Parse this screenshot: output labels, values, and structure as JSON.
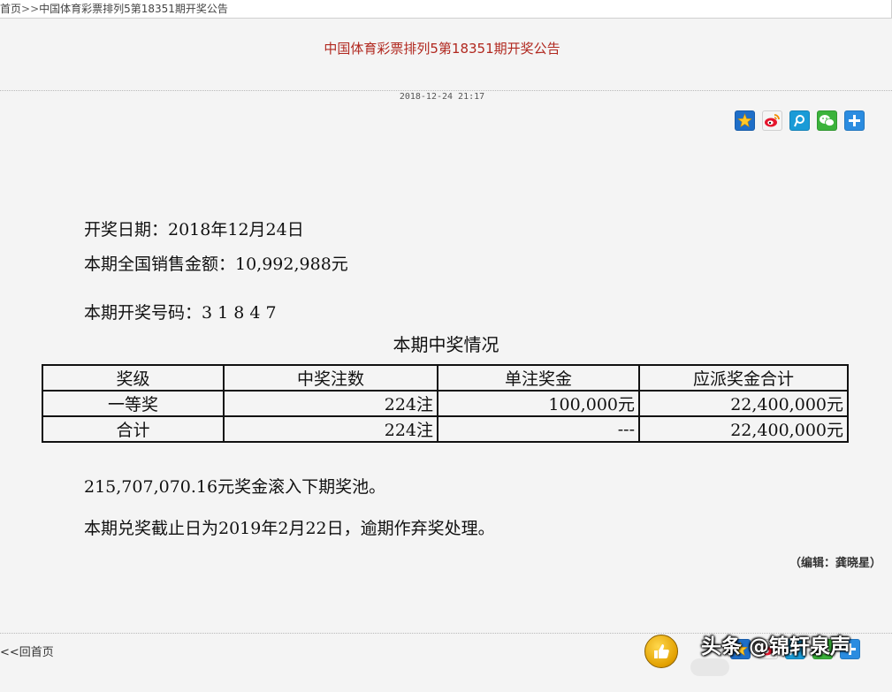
{
  "breadcrumb": {
    "home": "首页",
    "separator": ">>",
    "current": "中国体育彩票排列5第18351期开奖公告"
  },
  "article": {
    "title": "中国体育彩票排列5第18351期开奖公告",
    "publish_time": "2018-12-24 21:17",
    "draw_date_line": "开奖日期：2018年12月24日",
    "sales_line": "本期全国销售金额：10,992,988元",
    "numbers_line": "本期开奖号码：3 1 8 4 7",
    "section_title": "本期中奖情况",
    "table": {
      "headers": [
        "奖级",
        "中奖注数",
        "单注奖金",
        "应派奖金合计"
      ],
      "rows": [
        [
          "一等奖",
          "224注",
          "100,000元",
          "22,400,000元"
        ],
        [
          "合计",
          "224注",
          "---",
          "22,400,000元"
        ]
      ]
    },
    "rollover_line": "215,707,070.16元奖金滚入下期奖池。",
    "deadline_line": "本期兑奖截止日为2019年2月22日，逾期作弃奖处理。",
    "editor": "（编辑：龚晓星）"
  },
  "share_icons": [
    "qzone-icon",
    "weibo-icon",
    "tencent-weibo-icon",
    "wechat-icon",
    "more-share-icon"
  ],
  "footer": {
    "back_link": "<<回首页"
  },
  "watermark": "头条 @锦轩泉声",
  "colors": {
    "title_red": "#b1281f",
    "content_bg": "#f4f4f4"
  }
}
